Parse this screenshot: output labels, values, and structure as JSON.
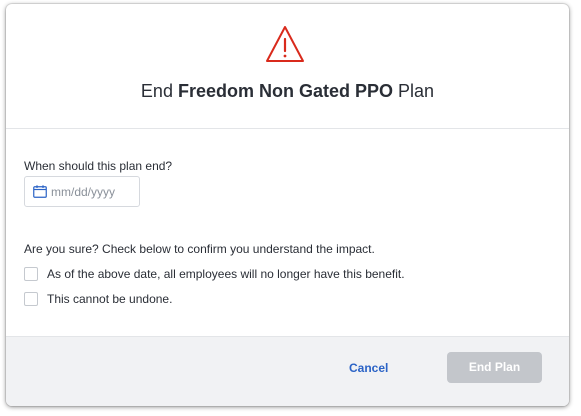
{
  "dialog": {
    "title_prefix": "End",
    "title_plan_name": "Freedom Non Gated PPO",
    "title_suffix": "Plan"
  },
  "form": {
    "end_date_label": "When should this plan end?",
    "end_date_placeholder": "mm/dd/yyyy",
    "end_date_value": "",
    "confirm_prompt": "Are you sure? Check below to confirm you understand the impact.",
    "checkboxes": [
      {
        "label": "As of the above date, all employees will no longer have this benefit.",
        "checked": false
      },
      {
        "label": "This cannot be undone.",
        "checked": false
      }
    ]
  },
  "footer": {
    "cancel_label": "Cancel",
    "end_plan_label": "End Plan",
    "end_plan_disabled": true
  },
  "icons": {
    "warning": "warning-triangle-icon",
    "calendar": "calendar-icon"
  },
  "colors": {
    "warning": "#d92a1c",
    "link": "#2b63c6",
    "disabled_button": "#c3c6cb",
    "footer_bg": "#f1f2f4"
  }
}
